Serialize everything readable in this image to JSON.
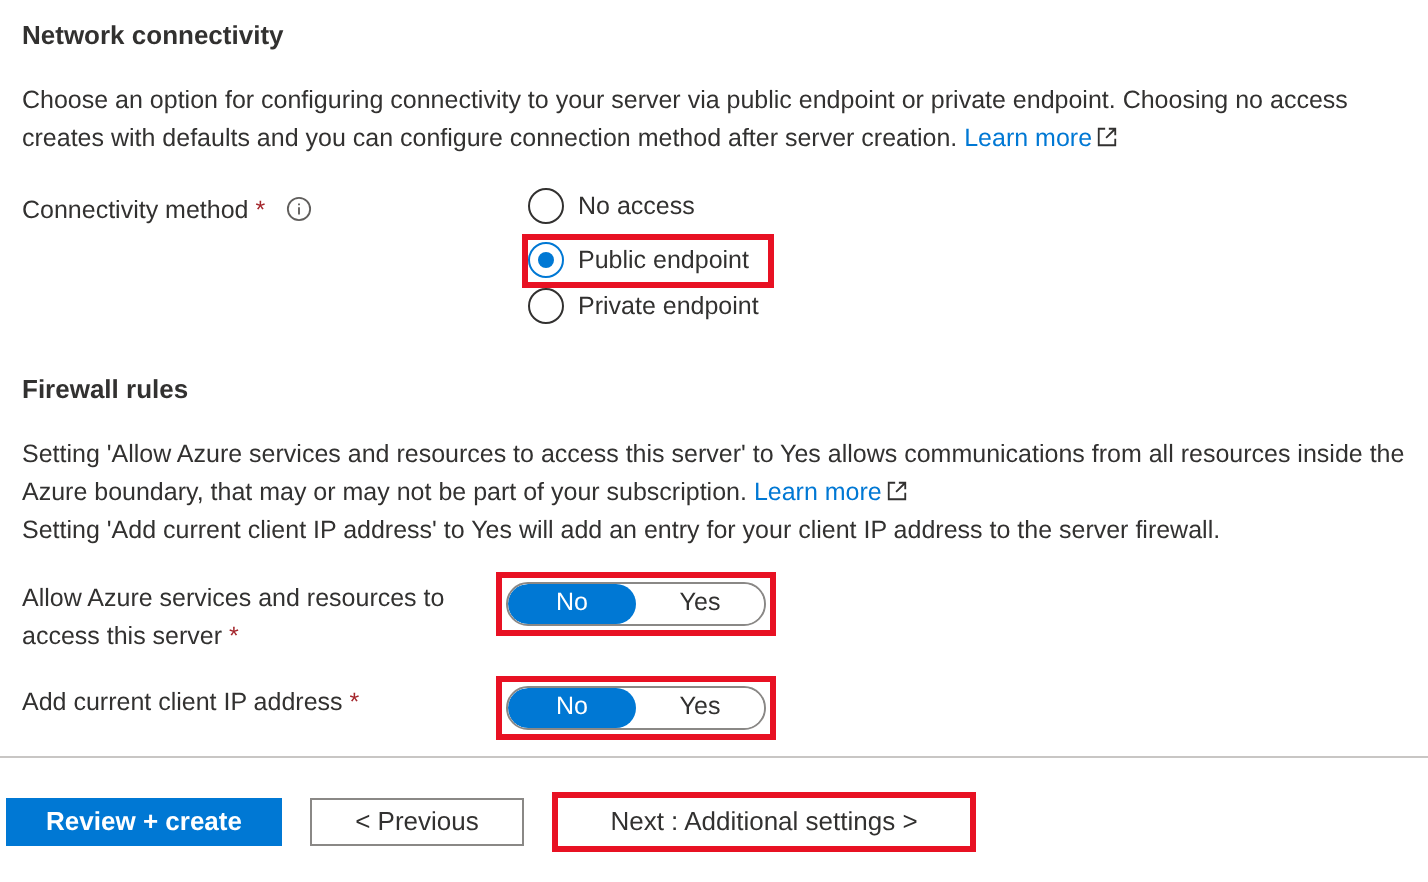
{
  "network": {
    "heading": "Network connectivity",
    "description": {
      "text": "Choose an option for configuring connectivity to your server via public endpoint or private endpoint. Choosing no access creates with defaults and you can configure connection method after server creation.",
      "link": "Learn more"
    },
    "connectivity_method": {
      "label": "Connectivity method",
      "required_mark": "*",
      "options": [
        {
          "label": "No access",
          "selected": false,
          "highlighted": false
        },
        {
          "label": "Public endpoint",
          "selected": true,
          "highlighted": true
        },
        {
          "label": "Private endpoint",
          "selected": false,
          "highlighted": false
        }
      ]
    }
  },
  "firewall": {
    "heading": "Firewall rules",
    "description": {
      "text": "Setting 'Allow Azure services and resources to access this server' to Yes allows communications from all resources inside the Azure boundary, that may or may not be part of your subscription.",
      "link": "Learn more"
    },
    "note": "Setting 'Add current client IP address' to Yes will add an entry for your client IP address to the server firewall.",
    "toggles": [
      {
        "label": "Allow Azure services and resources to access this server",
        "required_mark": "*",
        "highlighted": true,
        "options": [
          {
            "label": "No",
            "selected": true
          },
          {
            "label": "Yes",
            "selected": false
          }
        ]
      },
      {
        "label": "Add current client IP address",
        "required_mark": "*",
        "highlighted": true,
        "options": [
          {
            "label": "No",
            "selected": true
          },
          {
            "label": "Yes",
            "selected": false
          }
        ]
      }
    ]
  },
  "buttons": [
    {
      "label": "Review + create",
      "kind": "primary",
      "highlighted": false
    },
    {
      "label": "< Previous",
      "kind": "secondary",
      "highlighted": false
    },
    {
      "label": "Next : Additional settings >",
      "kind": "secondary",
      "highlighted": true
    }
  ]
}
